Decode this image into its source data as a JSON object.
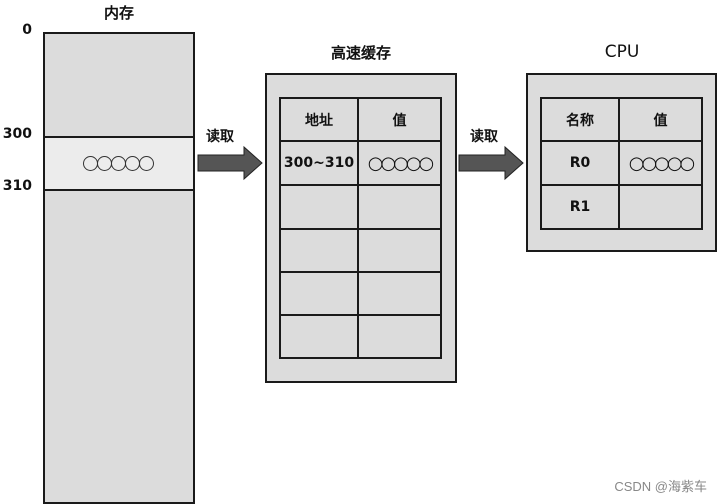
{
  "memory": {
    "title": "内存",
    "address_labels": [
      "0",
      "300",
      "310"
    ],
    "highlight_value_circles": 5
  },
  "arrows": [
    {
      "label": "读取",
      "from": "memory",
      "to": "cache"
    },
    {
      "label": "读取",
      "from": "cache",
      "to": "cpu"
    }
  ],
  "cache": {
    "title": "高速缓存",
    "headers": [
      "地址",
      "值"
    ],
    "rows": [
      [
        "300~310",
        "○○○○○"
      ],
      [
        "",
        ""
      ],
      [
        "",
        ""
      ],
      [
        "",
        ""
      ],
      [
        "",
        ""
      ]
    ]
  },
  "cpu": {
    "title": "CPU",
    "headers": [
      "名称",
      "值"
    ],
    "rows": [
      [
        "R0",
        "○○○○○"
      ],
      [
        "R1",
        ""
      ]
    ]
  },
  "watermark": "CSDN @海紫车",
  "colors": {
    "box_fill": "#dcdcdc",
    "highlight_fill": "#ececec",
    "arrow_fill": "#555555",
    "border": "#1a1a1a"
  }
}
